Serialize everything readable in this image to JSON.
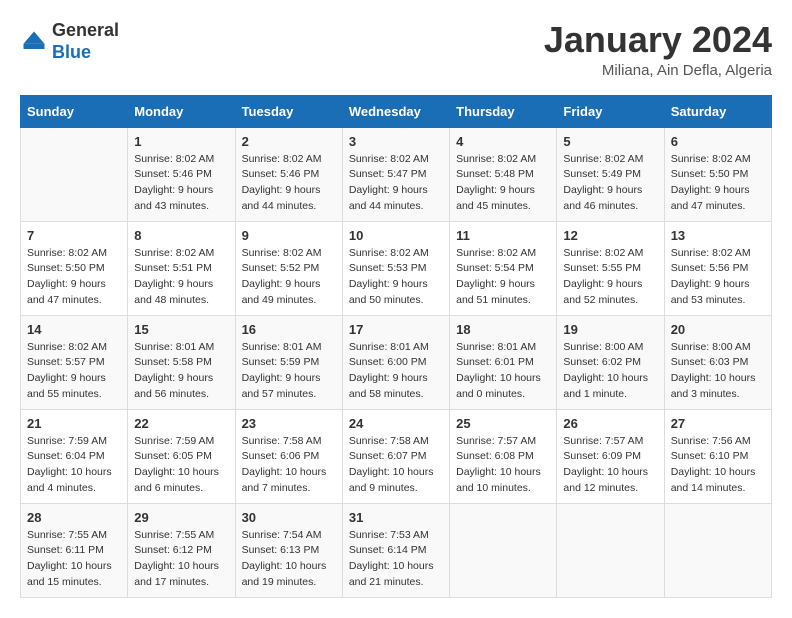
{
  "logo": {
    "general": "General",
    "blue": "Blue"
  },
  "title": "January 2024",
  "subtitle": "Miliana, Ain Defla, Algeria",
  "days_of_week": [
    "Sunday",
    "Monday",
    "Tuesday",
    "Wednesday",
    "Thursday",
    "Friday",
    "Saturday"
  ],
  "weeks": [
    [
      {
        "day": "",
        "info": ""
      },
      {
        "day": "1",
        "info": "Sunrise: 8:02 AM\nSunset: 5:46 PM\nDaylight: 9 hours\nand 43 minutes."
      },
      {
        "day": "2",
        "info": "Sunrise: 8:02 AM\nSunset: 5:46 PM\nDaylight: 9 hours\nand 44 minutes."
      },
      {
        "day": "3",
        "info": "Sunrise: 8:02 AM\nSunset: 5:47 PM\nDaylight: 9 hours\nand 44 minutes."
      },
      {
        "day": "4",
        "info": "Sunrise: 8:02 AM\nSunset: 5:48 PM\nDaylight: 9 hours\nand 45 minutes."
      },
      {
        "day": "5",
        "info": "Sunrise: 8:02 AM\nSunset: 5:49 PM\nDaylight: 9 hours\nand 46 minutes."
      },
      {
        "day": "6",
        "info": "Sunrise: 8:02 AM\nSunset: 5:50 PM\nDaylight: 9 hours\nand 47 minutes."
      }
    ],
    [
      {
        "day": "7",
        "info": "Sunrise: 8:02 AM\nSunset: 5:50 PM\nDaylight: 9 hours\nand 47 minutes."
      },
      {
        "day": "8",
        "info": "Sunrise: 8:02 AM\nSunset: 5:51 PM\nDaylight: 9 hours\nand 48 minutes."
      },
      {
        "day": "9",
        "info": "Sunrise: 8:02 AM\nSunset: 5:52 PM\nDaylight: 9 hours\nand 49 minutes."
      },
      {
        "day": "10",
        "info": "Sunrise: 8:02 AM\nSunset: 5:53 PM\nDaylight: 9 hours\nand 50 minutes."
      },
      {
        "day": "11",
        "info": "Sunrise: 8:02 AM\nSunset: 5:54 PM\nDaylight: 9 hours\nand 51 minutes."
      },
      {
        "day": "12",
        "info": "Sunrise: 8:02 AM\nSunset: 5:55 PM\nDaylight: 9 hours\nand 52 minutes."
      },
      {
        "day": "13",
        "info": "Sunrise: 8:02 AM\nSunset: 5:56 PM\nDaylight: 9 hours\nand 53 minutes."
      }
    ],
    [
      {
        "day": "14",
        "info": "Sunrise: 8:02 AM\nSunset: 5:57 PM\nDaylight: 9 hours\nand 55 minutes."
      },
      {
        "day": "15",
        "info": "Sunrise: 8:01 AM\nSunset: 5:58 PM\nDaylight: 9 hours\nand 56 minutes."
      },
      {
        "day": "16",
        "info": "Sunrise: 8:01 AM\nSunset: 5:59 PM\nDaylight: 9 hours\nand 57 minutes."
      },
      {
        "day": "17",
        "info": "Sunrise: 8:01 AM\nSunset: 6:00 PM\nDaylight: 9 hours\nand 58 minutes."
      },
      {
        "day": "18",
        "info": "Sunrise: 8:01 AM\nSunset: 6:01 PM\nDaylight: 10 hours\nand 0 minutes."
      },
      {
        "day": "19",
        "info": "Sunrise: 8:00 AM\nSunset: 6:02 PM\nDaylight: 10 hours\nand 1 minute."
      },
      {
        "day": "20",
        "info": "Sunrise: 8:00 AM\nSunset: 6:03 PM\nDaylight: 10 hours\nand 3 minutes."
      }
    ],
    [
      {
        "day": "21",
        "info": "Sunrise: 7:59 AM\nSunset: 6:04 PM\nDaylight: 10 hours\nand 4 minutes."
      },
      {
        "day": "22",
        "info": "Sunrise: 7:59 AM\nSunset: 6:05 PM\nDaylight: 10 hours\nand 6 minutes."
      },
      {
        "day": "23",
        "info": "Sunrise: 7:58 AM\nSunset: 6:06 PM\nDaylight: 10 hours\nand 7 minutes."
      },
      {
        "day": "24",
        "info": "Sunrise: 7:58 AM\nSunset: 6:07 PM\nDaylight: 10 hours\nand 9 minutes."
      },
      {
        "day": "25",
        "info": "Sunrise: 7:57 AM\nSunset: 6:08 PM\nDaylight: 10 hours\nand 10 minutes."
      },
      {
        "day": "26",
        "info": "Sunrise: 7:57 AM\nSunset: 6:09 PM\nDaylight: 10 hours\nand 12 minutes."
      },
      {
        "day": "27",
        "info": "Sunrise: 7:56 AM\nSunset: 6:10 PM\nDaylight: 10 hours\nand 14 minutes."
      }
    ],
    [
      {
        "day": "28",
        "info": "Sunrise: 7:55 AM\nSunset: 6:11 PM\nDaylight: 10 hours\nand 15 minutes."
      },
      {
        "day": "29",
        "info": "Sunrise: 7:55 AM\nSunset: 6:12 PM\nDaylight: 10 hours\nand 17 minutes."
      },
      {
        "day": "30",
        "info": "Sunrise: 7:54 AM\nSunset: 6:13 PM\nDaylight: 10 hours\nand 19 minutes."
      },
      {
        "day": "31",
        "info": "Sunrise: 7:53 AM\nSunset: 6:14 PM\nDaylight: 10 hours\nand 21 minutes."
      },
      {
        "day": "",
        "info": ""
      },
      {
        "day": "",
        "info": ""
      },
      {
        "day": "",
        "info": ""
      }
    ]
  ]
}
